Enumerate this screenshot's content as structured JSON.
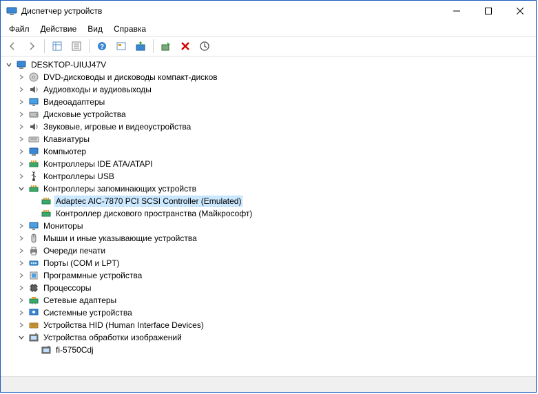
{
  "window": {
    "title": "Диспетчер устройств"
  },
  "menu": {
    "file": "Файл",
    "action": "Действие",
    "view": "Вид",
    "help": "Справка"
  },
  "tree": {
    "root": "DESKTOP-UIUJ47V",
    "items": [
      {
        "label": "DVD-дисководы и дисководы компакт-дисков",
        "icon": "disc",
        "twisty": "closed"
      },
      {
        "label": "Аудиовходы и аудиовыходы",
        "icon": "audio",
        "twisty": "closed"
      },
      {
        "label": "Видеоадаптеры",
        "icon": "display",
        "twisty": "closed"
      },
      {
        "label": "Дисковые устройства",
        "icon": "drive",
        "twisty": "closed"
      },
      {
        "label": "Звуковые, игровые и видеоустройства",
        "icon": "audio",
        "twisty": "closed"
      },
      {
        "label": "Клавиатуры",
        "icon": "keyboard",
        "twisty": "closed"
      },
      {
        "label": "Компьютер",
        "icon": "computer",
        "twisty": "closed"
      },
      {
        "label": "Контроллеры IDE ATA/ATAPI",
        "icon": "controller",
        "twisty": "closed"
      },
      {
        "label": "Контроллеры USB",
        "icon": "usb",
        "twisty": "closed"
      },
      {
        "label": "Контроллеры запоминающих устройств",
        "icon": "controller",
        "twisty": "open",
        "children": [
          {
            "label": "Adaptec AIC-7870 PCI SCSI Controller (Emulated)",
            "icon": "controller",
            "selected": true
          },
          {
            "label": "Контроллер дискового пространства (Майкрософт)",
            "icon": "controller"
          }
        ]
      },
      {
        "label": "Мониторы",
        "icon": "display",
        "twisty": "closed"
      },
      {
        "label": "Мыши и иные указывающие устройства",
        "icon": "mouse",
        "twisty": "closed"
      },
      {
        "label": "Очереди печати",
        "icon": "printer",
        "twisty": "closed"
      },
      {
        "label": "Порты (COM и LPT)",
        "icon": "port",
        "twisty": "closed"
      },
      {
        "label": "Программные устройства",
        "icon": "software",
        "twisty": "closed"
      },
      {
        "label": "Процессоры",
        "icon": "cpu",
        "twisty": "closed"
      },
      {
        "label": "Сетевые адаптеры",
        "icon": "network",
        "twisty": "closed"
      },
      {
        "label": "Системные устройства",
        "icon": "system",
        "twisty": "closed"
      },
      {
        "label": "Устройства HID (Human Interface Devices)",
        "icon": "hid",
        "twisty": "closed"
      },
      {
        "label": "Устройства обработки изображений",
        "icon": "imaging",
        "twisty": "open",
        "children": [
          {
            "label": "fi-5750Cdj",
            "icon": "imaging"
          }
        ]
      }
    ]
  }
}
